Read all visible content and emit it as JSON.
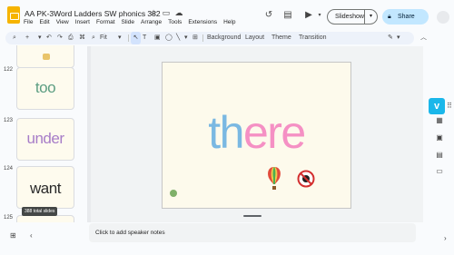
{
  "header": {
    "doc_title": "AA PK-3Word Ladders SW phonics  382",
    "menu": [
      "File",
      "Edit",
      "View",
      "Insert",
      "Format",
      "Slide",
      "Arrange",
      "Tools",
      "Extensions",
      "Help"
    ],
    "slideshow_label": "Slideshow",
    "share_label": "Share"
  },
  "toolbar": {
    "zoom": "Fit",
    "background_label": "Background",
    "layout_label": "Layout",
    "theme_label": "Theme",
    "transition_label": "Transition"
  },
  "filmstrip": {
    "slides": [
      {
        "number": "122",
        "word": "too"
      },
      {
        "number": "123",
        "word": "under"
      },
      {
        "number": "124",
        "word": "want"
      },
      {
        "number": "125"
      }
    ],
    "total_tooltip": "388 total slides"
  },
  "main_slide": {
    "word_parts": [
      {
        "text": "th",
        "color": "#7ab8e2"
      },
      {
        "text": "ere",
        "color": "#f590c4"
      }
    ],
    "icon_names": [
      "hot-air-balloon-icon",
      "no-symbol-icon"
    ]
  },
  "notes": {
    "placeholder": "Click to add speaker notes"
  },
  "colors": {
    "share_bg": "#c2e7ff",
    "vimeo": "#1ab7ea",
    "slide_bg": "#fdfaec"
  }
}
